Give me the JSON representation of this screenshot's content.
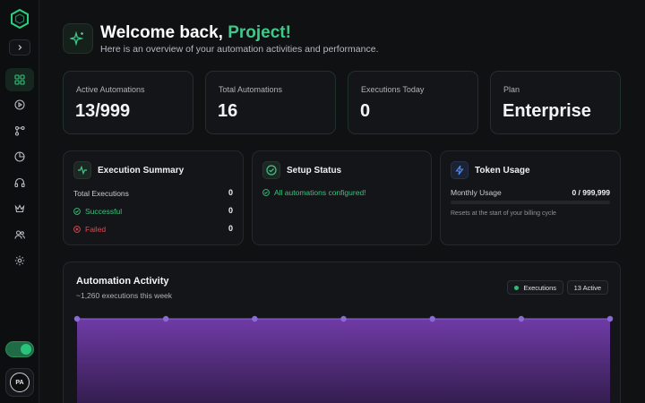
{
  "sidebar": {
    "nav_icons": [
      "grid-icon",
      "play-icon",
      "flow-icon",
      "chart-pie-icon",
      "headset-icon",
      "crown-icon",
      "users-icon",
      "gear-icon"
    ],
    "avatar_initials": "PA",
    "toggle_on": true
  },
  "header": {
    "greeting": "Welcome back,",
    "name": "Project!",
    "subtitle": "Here is an overview of your automation activities and performance."
  },
  "stats": [
    {
      "label": "Active Automations",
      "value": "13/999"
    },
    {
      "label": "Total Automations",
      "value": "16"
    },
    {
      "label": "Executions Today",
      "value": "0"
    },
    {
      "label": "Plan",
      "value": "Enterprise"
    }
  ],
  "execution_summary": {
    "title": "Execution Summary",
    "total_label": "Total Executions",
    "total_value": "0",
    "success_label": "Successful",
    "success_value": "0",
    "failed_label": "Failed",
    "failed_value": "0"
  },
  "setup_status": {
    "title": "Setup Status",
    "message": "All automations configured!"
  },
  "token_usage": {
    "title": "Token Usage",
    "monthly_label": "Monthly Usage",
    "monthly_value": "0 / 999,999",
    "used_fraction": 0,
    "note": "Resets at the start of your billing cycle"
  },
  "activity": {
    "title": "Automation Activity",
    "subtitle": "~1,260 executions this week",
    "legend_label": "Executions",
    "active_badge": "13 Active"
  },
  "colors": {
    "accent": "#3ec98a",
    "chart_fill": "#6a3a9a",
    "chart_point": "#8c6ad6"
  }
}
